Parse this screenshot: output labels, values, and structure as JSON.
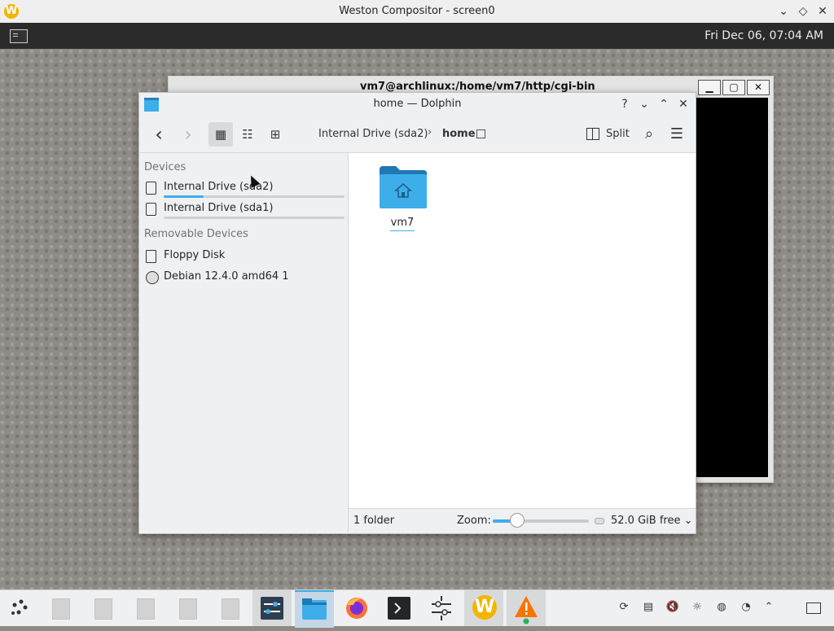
{
  "weston": {
    "title": "Weston Compositor - screen0",
    "logo_letter": "W",
    "controls": [
      "⌄",
      "◇",
      "✕"
    ]
  },
  "top_panel": {
    "clock": "Fri Dec 06, 07:04 AM",
    "terminal_icon": "terminal-icon"
  },
  "terminal_window": {
    "title": "vm7@archlinux:/home/vm7/http/cgi-bin",
    "buttons": [
      "▁",
      "▢",
      "✕"
    ]
  },
  "dolphin": {
    "title": "home — Dolphin",
    "title_controls": [
      "?",
      "⌄",
      "⌃",
      "✕"
    ],
    "toolbar": {
      "back": "‹",
      "forward": "›",
      "view_icons": "▦",
      "view_compact": "☷",
      "view_details": "⊞",
      "split_label": "Split",
      "search": "⌕",
      "menu": "☰"
    },
    "breadcrumb": {
      "parent": "Internal Drive (sda2)",
      "separator": "›",
      "current": "home"
    },
    "places": {
      "devices_header": "Devices",
      "removable_header": "Removable Devices",
      "devices": [
        {
          "label": "Internal Drive (sda2)",
          "usage_fraction": 0.22,
          "icon": "hard-drive-icon"
        },
        {
          "label": "Internal Drive (sda1)",
          "usage_fraction": 0.0,
          "icon": "hard-drive-icon"
        }
      ],
      "removable": [
        {
          "label": "Floppy Disk",
          "icon": "floppy-icon"
        },
        {
          "label": "Debian 12.4.0 amd64 1",
          "icon": "optical-disc-icon"
        }
      ]
    },
    "content": {
      "items": [
        {
          "label": "vm7",
          "icon": "home-folder-icon"
        }
      ]
    },
    "statusbar": {
      "count": "1 folder",
      "zoom_label": "Zoom:",
      "zoom_fraction": 0.25,
      "free_space": "52.0 GiB free ⌄"
    },
    "accent": "#3daee9"
  },
  "taskbar": {
    "items": [
      "app-launcher-icon",
      "document-icon",
      "document-icon",
      "document-icon",
      "document-icon",
      "document-icon",
      "system-settings-icon",
      "dolphin-folder-icon",
      "firefox-icon",
      "terminal-icon",
      "mixer-icon",
      "weston-icon",
      "warning-icon"
    ],
    "tray": [
      "network-icon",
      "clipboard-icon",
      "volume-muted-icon",
      "brightness-icon",
      "globe-icon",
      "clock-icon",
      "expand-icon",
      "show-desktop-icon"
    ]
  }
}
